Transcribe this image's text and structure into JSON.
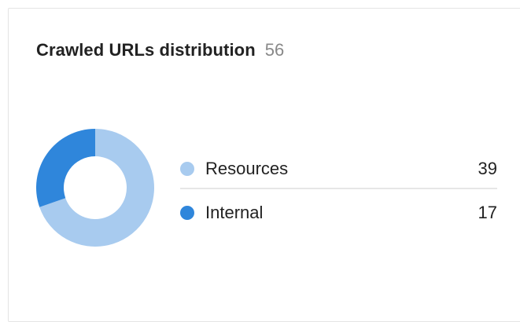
{
  "card": {
    "title": "Crawled URLs distribution",
    "count": "56"
  },
  "chart_data": {
    "type": "pie",
    "title": "Crawled URLs distribution",
    "total": 56,
    "donut": true,
    "legend_position": "right",
    "categories": [
      "Resources",
      "Internal"
    ],
    "values": [
      39,
      17
    ],
    "colors": [
      "#a8cbef",
      "#2f86db"
    ]
  },
  "legend": [
    {
      "label": "Resources",
      "value": "39",
      "color": "#a8cbef"
    },
    {
      "label": "Internal",
      "value": "17",
      "color": "#2f86db"
    }
  ]
}
